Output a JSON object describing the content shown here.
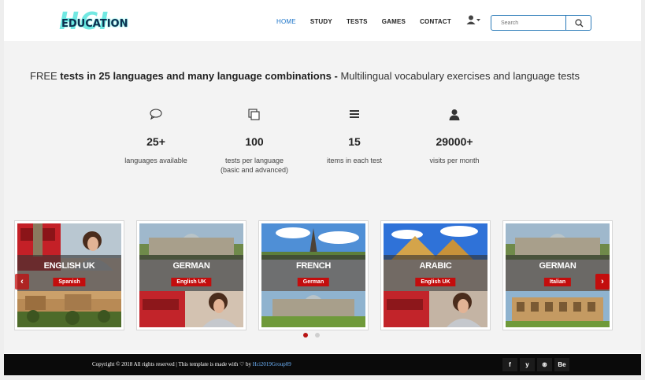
{
  "header": {
    "logo_top": "HCI",
    "logo_bottom": "EDUCATION",
    "nav": [
      {
        "label": "HOME",
        "active": true
      },
      {
        "label": "STUDY",
        "active": false
      },
      {
        "label": "TESTS",
        "active": false
      },
      {
        "label": "GAMES",
        "active": false
      },
      {
        "label": "CONTACT",
        "active": false
      }
    ],
    "user_icon": "user-dropdown-icon",
    "search": {
      "placeholder": "Search",
      "icon": "search-icon"
    }
  },
  "headline": {
    "part1": "FREE ",
    "part2": "tests in 25 languages and many language combinations - ",
    "part3": "Multilingual vocabulary exercises and language tests"
  },
  "stats": [
    {
      "icon": "speech-bubble-icon",
      "value": "25+",
      "label": "languages available"
    },
    {
      "icon": "copy-pages-icon",
      "value": "100",
      "label": "tests per language",
      "label2": "(basic and advanced)"
    },
    {
      "icon": "list-lines-icon",
      "value": "15",
      "label": "items in each test"
    },
    {
      "icon": "user-icon",
      "value": "29000+",
      "label": "visits per month"
    }
  ],
  "cards": [
    {
      "title": "ENGLISH UK",
      "tag": "Spanish"
    },
    {
      "title": "GERMAN",
      "tag": "English UK"
    },
    {
      "title": "FRENCH",
      "tag": "German"
    },
    {
      "title": "ARABIC",
      "tag": "English UK"
    },
    {
      "title": "GERMAN",
      "tag": "Italian"
    }
  ],
  "carousel": {
    "prev": "‹",
    "next": "›",
    "pages": 2,
    "active_page": 1
  },
  "footer": {
    "copyright": "Copyright © 2018 All rights reserved | This template is made with ♡ by ",
    "author": "Hci2019Group09",
    "social": [
      "f",
      "y",
      "⊛",
      "Be"
    ]
  },
  "colors": {
    "accent": "#1a73c8",
    "brand_red": "#c30d0d",
    "footer_bg": "#0a0a0a"
  }
}
